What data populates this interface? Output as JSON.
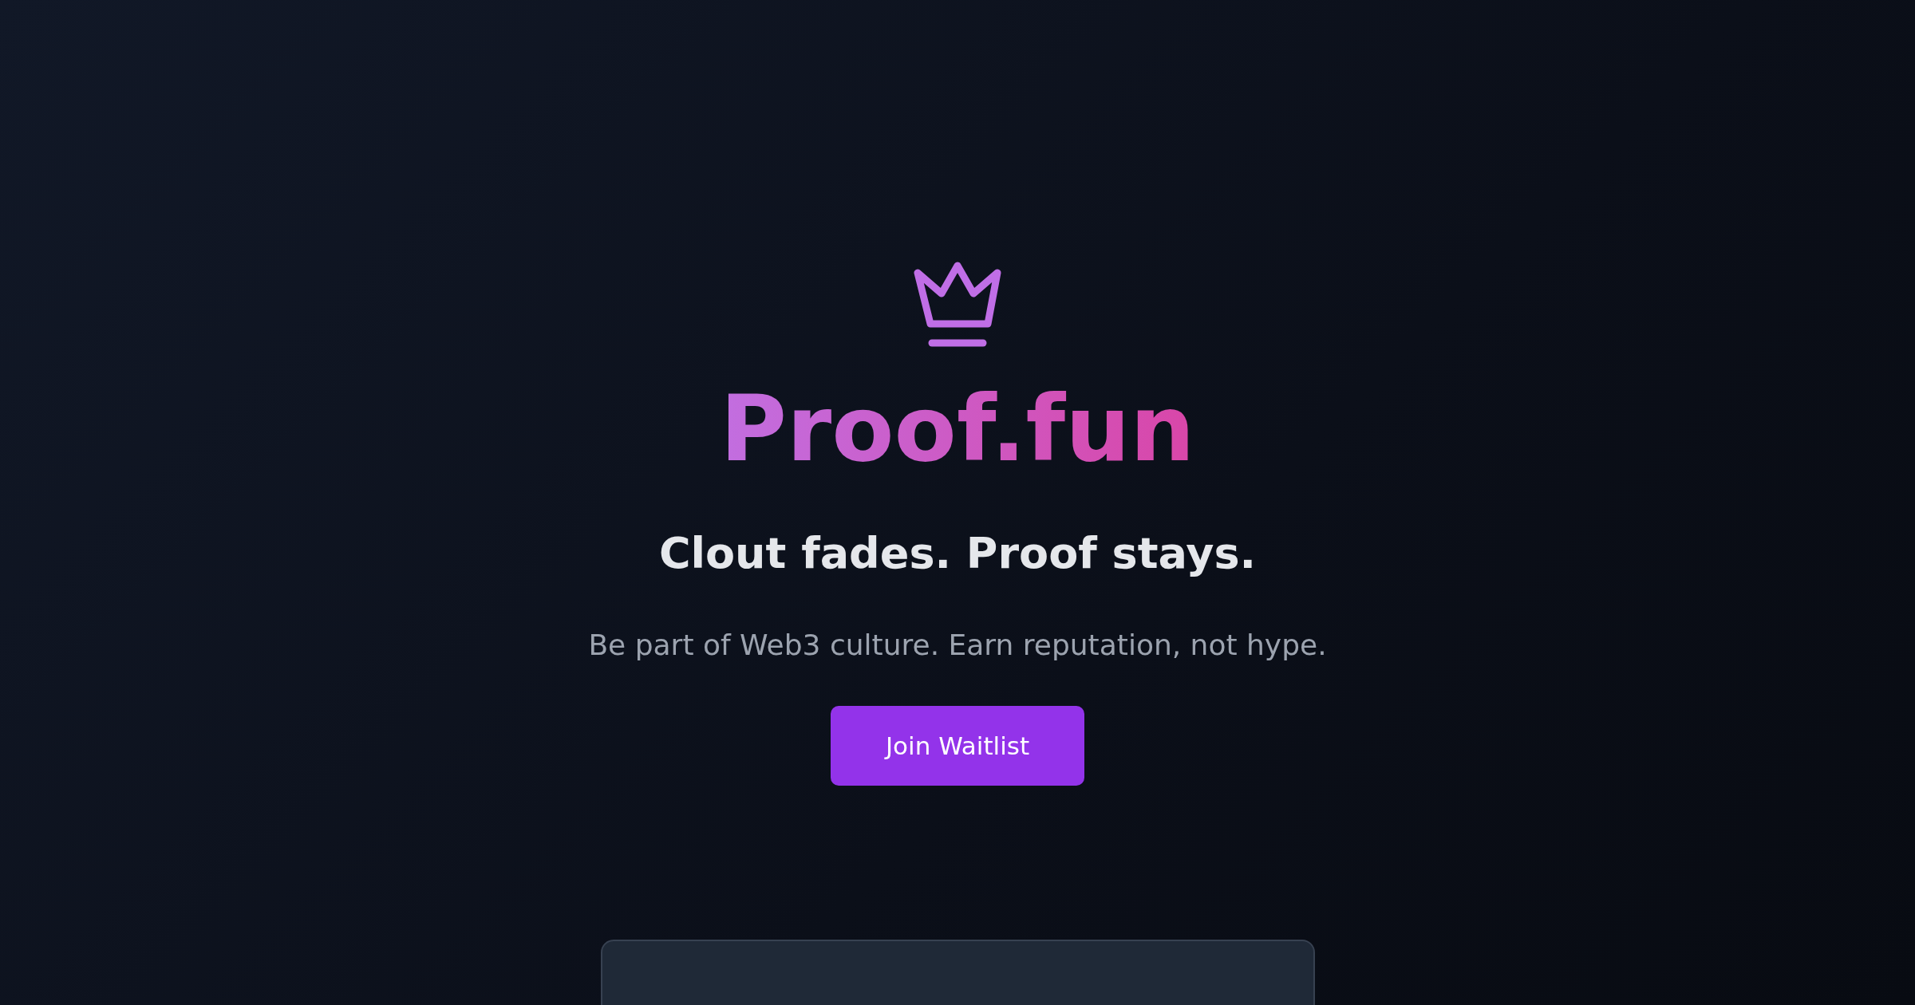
{
  "hero": {
    "title": "Proof.fun",
    "tagline": "Clout fades. Proof stays.",
    "description": "Be part of Web3 culture. Earn reputation, not hype.",
    "button": "Join Waitlist"
  }
}
